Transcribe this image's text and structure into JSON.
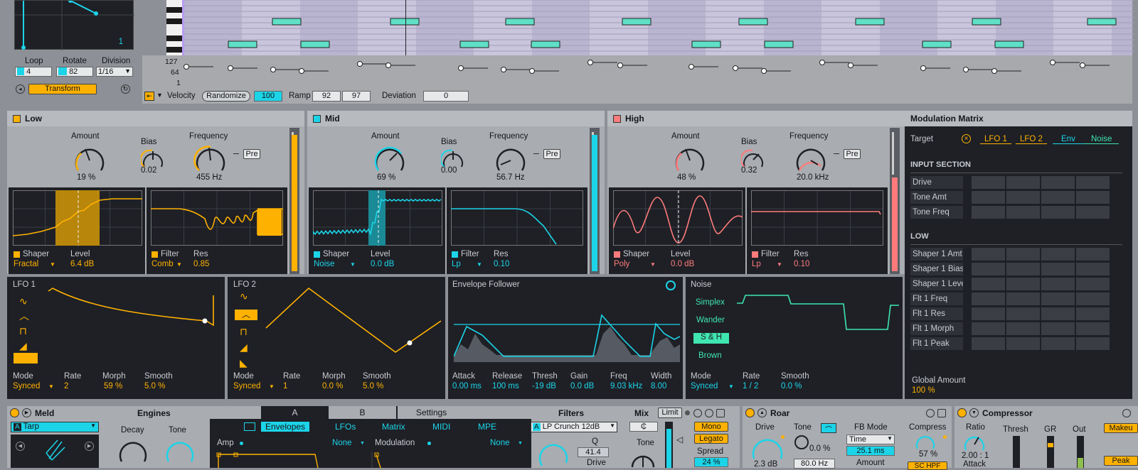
{
  "top": {
    "loop_label": "Loop",
    "loop_value": "4",
    "rotate_label": "Rotate",
    "rotate_value": "82",
    "division_label": "Division",
    "division_value": "1/16",
    "xy_value": "1",
    "transform_label": "Transform",
    "vel_ticks": [
      "127",
      "64",
      "1"
    ],
    "velocity_label": "Velocity",
    "randomize_label": "Randomize",
    "randomize_value": "100",
    "ramp_label": "Ramp",
    "ramp_a": "92",
    "ramp_b": "97",
    "deviation_label": "Deviation",
    "deviation_value": "0"
  },
  "bands": [
    {
      "title": "Low",
      "amount_label": "Amount",
      "amount": "19 %",
      "bias_label": "Bias",
      "bias": "0.02",
      "freq_label": "Frequency",
      "freq": "455 Hz",
      "pre": "Pre",
      "shaper_label": "Shaper",
      "shaper": "Fractal",
      "level_label": "Level",
      "level": "6.4 dB",
      "filter_label": "Filter",
      "filter": "Comb",
      "res_label": "Res",
      "res": "0.85"
    },
    {
      "title": "Mid",
      "amount_label": "Amount",
      "amount": "69 %",
      "bias_label": "Bias",
      "bias": "0.00",
      "freq_label": "Frequency",
      "freq": "56.7 Hz",
      "pre": "Pre",
      "shaper_label": "Shaper",
      "shaper": "Noise",
      "level_label": "Level",
      "level": "0.0 dB",
      "filter_label": "Filter",
      "filter": "Lp",
      "res_label": "Res",
      "res": "0.10"
    },
    {
      "title": "High",
      "amount_label": "Amount",
      "amount": "48 %",
      "bias_label": "Bias",
      "bias": "0.32",
      "freq_label": "Frequency",
      "freq": "20.0 kHz",
      "pre": "Pre",
      "shaper_label": "Shaper",
      "shaper": "Poly",
      "level_label": "Level",
      "level": "0.0 dB",
      "filter_label": "Filter",
      "filter": "Lp",
      "res_label": "Res",
      "res": "0.10"
    }
  ],
  "matrix": {
    "title": "Modulation Matrix",
    "target_label": "Target",
    "sources": [
      "LFO 1",
      "LFO 2",
      "Env",
      "Noise"
    ],
    "input_section": "INPUT SECTION",
    "input_rows": [
      "Drive",
      "Tone Amt",
      "Tone Freq"
    ],
    "low_section": "LOW",
    "low_rows": [
      "Shaper 1 Amt",
      "Shaper 1 Bias",
      "Shaper 1 Level",
      "Flt 1 Freq",
      "Flt 1 Res",
      "Flt 1 Morph",
      "Flt 1 Peak"
    ],
    "global_label": "Global Amount",
    "global_value": "100 %"
  },
  "lfo1": {
    "title": "LFO 1",
    "mode_label": "Mode",
    "mode": "Synced",
    "rate_label": "Rate",
    "rate": "2",
    "morph_label": "Morph",
    "morph": "59 %",
    "smooth_label": "Smooth",
    "smooth": "5.0 %"
  },
  "lfo2": {
    "title": "LFO 2",
    "mode_label": "Mode",
    "mode": "Synced",
    "rate_label": "Rate",
    "rate": "1",
    "morph_label": "Morph",
    "morph": "0.0 %",
    "smooth_label": "Smooth",
    "smooth": "5.0 %"
  },
  "env": {
    "title": "Envelope Follower",
    "attack_label": "Attack",
    "attack": "0.00 ms",
    "release_label": "Release",
    "release": "100 ms",
    "thresh_label": "Thresh",
    "thresh": "-19 dB",
    "gain_label": "Gain",
    "gain": "0.0 dB",
    "freq_label": "Freq",
    "freq": "9.03 kHz",
    "width_label": "Width",
    "width": "8.00"
  },
  "noise": {
    "title": "Noise",
    "types": [
      "Simplex",
      "Wander",
      "S & H",
      "Brown"
    ],
    "mode_label": "Mode",
    "mode": "Synced",
    "rate_label": "Rate",
    "rate": "1 / 2",
    "smooth_label": "Smooth",
    "smooth": "0.0 %"
  },
  "meld": {
    "title": "Meld",
    "engines": "Engines",
    "preset": "Tarp",
    "decay": "Decay",
    "tone": "Tone",
    "tab_a": "A",
    "tab_b": "B",
    "tab_settings": "Settings",
    "subtabs": [
      "Envelopes",
      "LFOs",
      "Matrix",
      "MIDI",
      "MPE"
    ],
    "amp_label": "Amp",
    "amp_none": "None",
    "mod_label": "Modulation",
    "mod_none": "None",
    "filters_label": "Filters",
    "filter_type": "LP Crunch 12dB",
    "q_label": "Q",
    "q_value": "41.4",
    "drive_label": "Drive",
    "mix_label": "Mix",
    "limit_label": "Limit",
    "tone2_label": "Tone",
    "mono": "Mono",
    "legato": "Legato",
    "spread_label": "Spread",
    "spread_value": "24 %"
  },
  "roar": {
    "title": "Roar",
    "drive_label": "Drive",
    "drive_value": "2.3 dB",
    "tone_label": "Tone",
    "tone_value": "0.0 %",
    "tone_freq": "80.0 Hz",
    "fb_mode_label": "FB Mode",
    "fb_mode": "Time",
    "fb_value": "25.1 ms",
    "amount_label": "Amount",
    "compress_label": "Compress",
    "compress_value": "57 %",
    "schpf": "SC HPF"
  },
  "comp": {
    "title": "Compressor",
    "ratio_label": "Ratio",
    "ratio_value": "2.00 : 1",
    "attack_label": "Attack",
    "thresh_label": "Thresh",
    "gr_label": "GR",
    "out_label": "Out",
    "makeup": "Makeu",
    "peak": "Peak"
  },
  "colors": {
    "yellow": "#ffb100",
    "cyan": "#1cd4e8",
    "pink": "#ff7b7b",
    "green": "#3fe6b0"
  }
}
